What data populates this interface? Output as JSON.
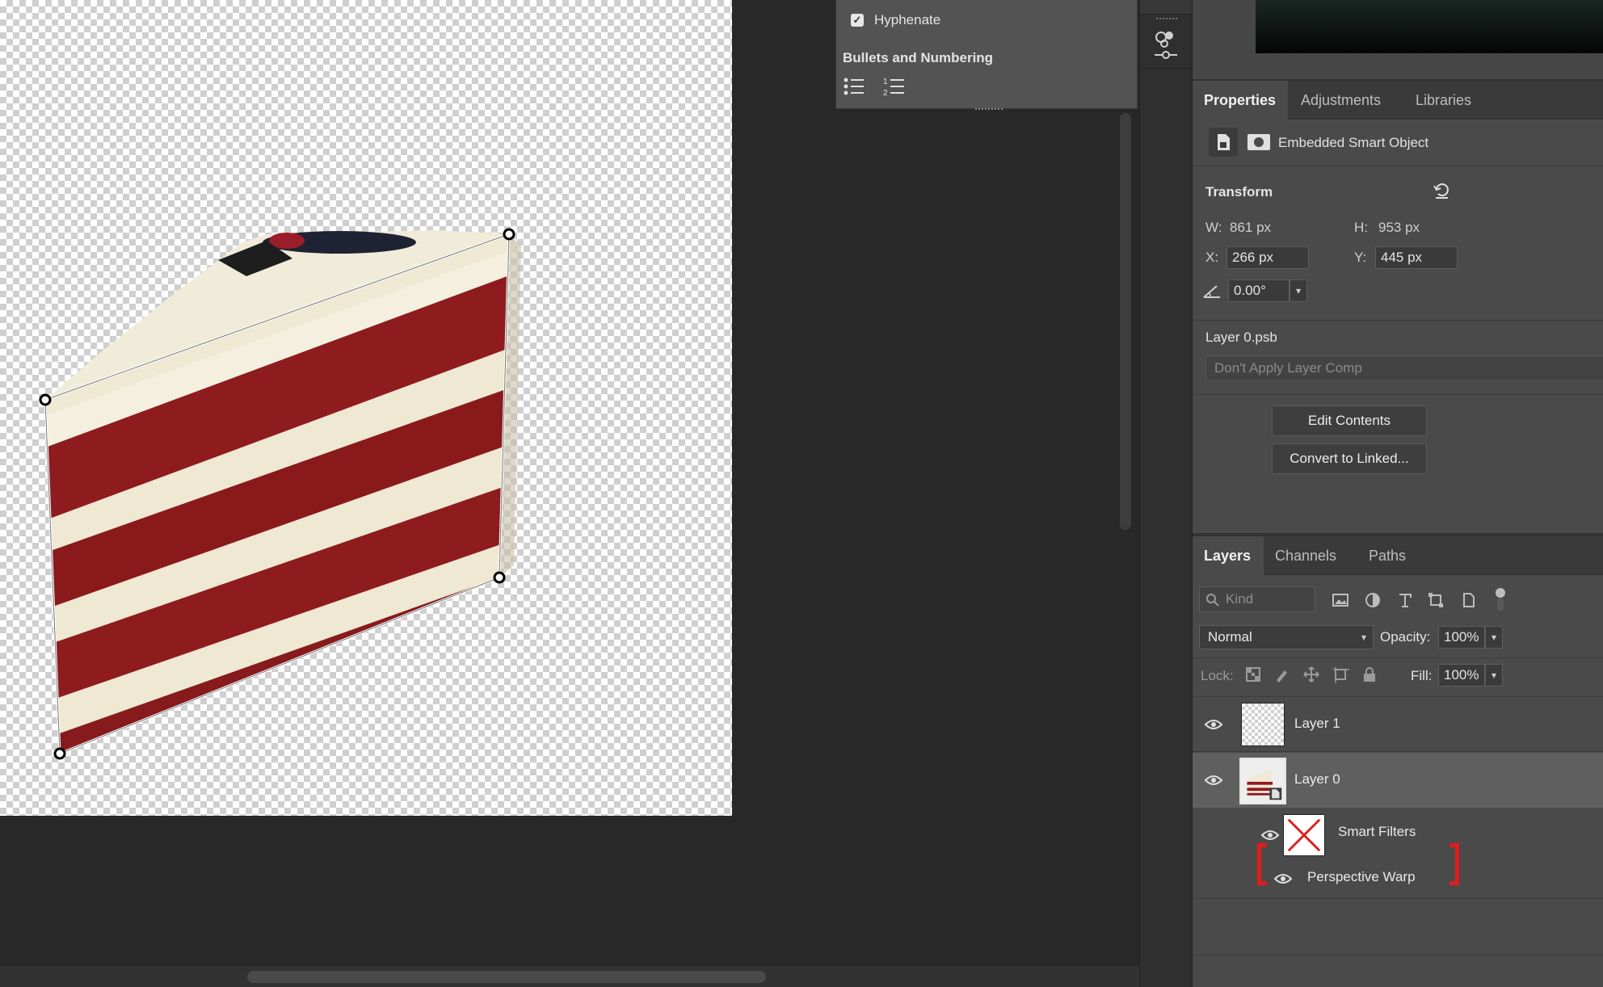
{
  "paragraph_panel": {
    "hyphenate_checked": true,
    "hyphenate_label": "Hyphenate",
    "bullets_title": "Bullets and Numbering",
    "bullet_buttons": [
      "bulleted-list-icon",
      "numbered-list-icon"
    ]
  },
  "properties": {
    "tabs": [
      "Properties",
      "Adjustments",
      "Libraries"
    ],
    "active_tab": "Properties",
    "object_type_label": "Embedded Smart Object",
    "transform": {
      "title": "Transform",
      "w_label": "W:",
      "w_value": "861 px",
      "h_label": "H:",
      "h_value": "953 px",
      "x_label": "X:",
      "x_value": "266 px",
      "y_label": "Y:",
      "y_value": "445 px",
      "angle_value": "0.00°"
    },
    "source_file": "Layer 0.psb",
    "layer_comp_placeholder": "Don't Apply Layer Comp",
    "edit_contents_label": "Edit Contents",
    "convert_label": "Convert to Linked..."
  },
  "layers_panel": {
    "tabs": [
      "Layers",
      "Channels",
      "Paths"
    ],
    "active_tab": "Layers",
    "kind_placeholder": "Kind",
    "blend_mode": "Normal",
    "opacity_label": "Opacity:",
    "opacity_value": "100%",
    "lock_label": "Lock:",
    "fill_label": "Fill:",
    "fill_value": "100%",
    "layers": [
      {
        "name": "Layer 1",
        "visible": true,
        "selected": false
      },
      {
        "name": "Layer 0",
        "visible": true,
        "selected": true
      }
    ],
    "smart_filters_label": "Smart Filters",
    "filter_name": "Perspective Warp",
    "highlight_color": "#e21b1b"
  },
  "colors": {
    "canvas_bg": "#282828",
    "panel_bg": "#4a4a4a",
    "cake_red": "#8c1a1c",
    "cake_cream": "#efe9d6"
  }
}
